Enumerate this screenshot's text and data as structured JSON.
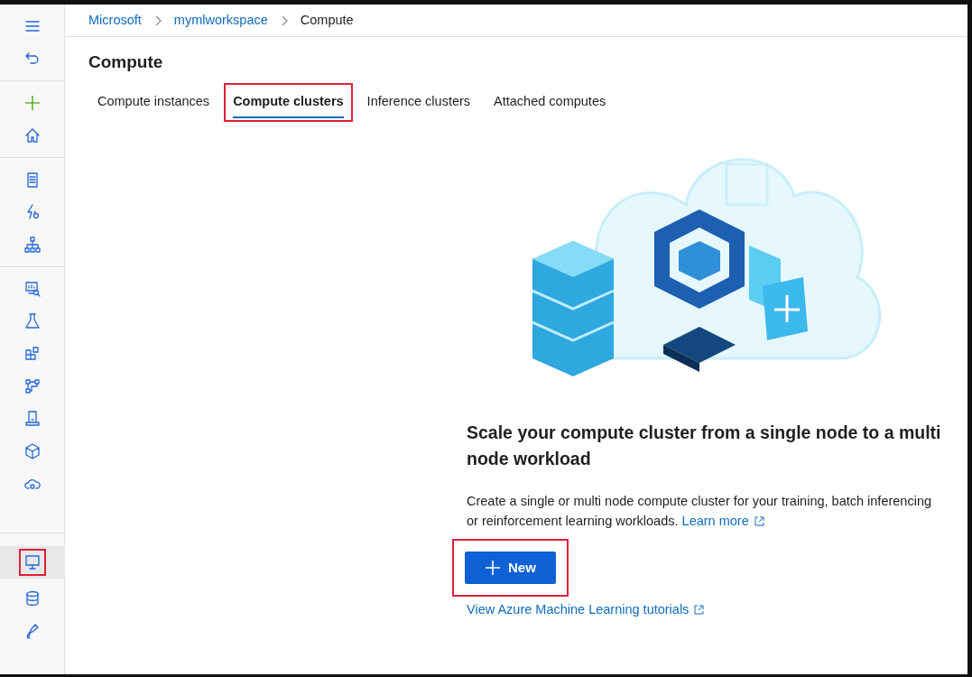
{
  "sidebar": {
    "groups": [
      {
        "items": [
          {
            "selected": false,
            "highlighted": false
          },
          {
            "selected": false,
            "highlighted": false
          }
        ]
      },
      {
        "items": [
          {
            "selected": false,
            "highlighted": false
          },
          {
            "selected": false,
            "highlighted": false
          }
        ]
      },
      {
        "items": [
          {
            "selected": false,
            "highlighted": false
          },
          {
            "selected": false,
            "highlighted": false
          },
          {
            "selected": false,
            "highlighted": false
          }
        ]
      },
      {
        "items": [
          {
            "selected": false,
            "highlighted": false
          },
          {
            "selected": false,
            "highlighted": false
          },
          {
            "selected": false,
            "highlighted": false
          },
          {
            "selected": false,
            "highlighted": false
          },
          {
            "selected": false,
            "highlighted": false
          },
          {
            "selected": false,
            "highlighted": false
          },
          {
            "selected": false,
            "highlighted": false
          }
        ]
      },
      {
        "items": [
          {
            "selected": true,
            "highlighted": true
          },
          {
            "selected": false,
            "highlighted": false
          },
          {
            "selected": false,
            "highlighted": false
          }
        ]
      }
    ]
  },
  "breadcrumb": [
    {
      "label": "Microsoft",
      "link": true
    },
    {
      "label": "mymlworkspace",
      "link": true
    },
    {
      "label": "Compute",
      "link": false
    }
  ],
  "page_title": "Compute",
  "tabs": [
    {
      "label": "Compute instances",
      "selected": false,
      "highlighted": false
    },
    {
      "label": "Compute clusters",
      "selected": true,
      "highlighted": true
    },
    {
      "label": "Inference clusters",
      "selected": false,
      "highlighted": false
    },
    {
      "label": "Attached computes",
      "selected": false,
      "highlighted": false
    }
  ],
  "empty_state": {
    "heading": "Scale your compute cluster from a single node to a multi node workload",
    "description": "Create a single or multi node compute cluster for your training, batch inferencing or reinforcement learning workloads.",
    "learn_more": "Learn more",
    "new_button": {
      "label": "New",
      "highlighted": true
    },
    "tutorials_link": "View Azure Machine Learning tutorials"
  }
}
